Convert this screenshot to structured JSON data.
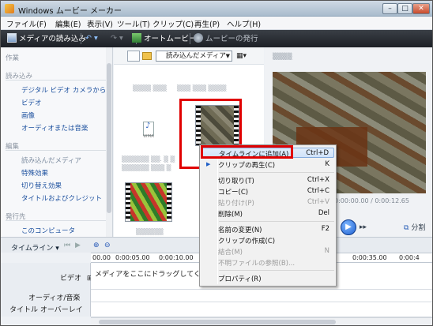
{
  "window": {
    "title": "Windows ムービー メーカー",
    "min": "–",
    "max": "□",
    "close": "✕"
  },
  "menu": [
    "ファイル(F)",
    "編集(E)",
    "表示(V)",
    "ツール(T)",
    "クリップ(C)",
    "再生(P)",
    "ヘルプ(H)"
  ],
  "toolbar": {
    "import": "メディアの読み込み",
    "automovie": "オートムービー",
    "publish": "ムービーの発行"
  },
  "taskpane": {
    "tasks_header": "作業",
    "import_header": "読み込み",
    "import_links": [
      "デジタル ビデオ カメラから",
      "ビデオ",
      "画像",
      "オーディオまたは音楽"
    ],
    "edit_header": "編集",
    "edit_links": [
      "読み込んだメディア",
      "特殊効果",
      "切り替え効果",
      "タイトルおよびクレジット"
    ],
    "publish_header": "発行先",
    "publish_links": [
      "このコンピュータ"
    ]
  },
  "content": {
    "combo": "読み込んだメディア",
    "audio_label": "WMA"
  },
  "preview": {
    "time": "0:00:00.00 / 0:00:12.65",
    "split": "分割"
  },
  "timeline": {
    "label": "タイムライン",
    "ruler": [
      "00.00",
      "0:00:05.00",
      "0:00:10.00",
      "0:00:35.00",
      "0:00:4"
    ],
    "tracks": [
      "ビデオ",
      "オーディオ/音楽",
      "タイトル オーバーレイ"
    ],
    "drop_hint": "メディアをここにドラッグしてくださ"
  },
  "context_menu": {
    "items": [
      {
        "label": "タイムラインに追加(A)",
        "shortcut": "Ctrl+D",
        "disabled": false
      },
      {
        "label": "クリップの再生(C)",
        "shortcut": "K",
        "disabled": false
      },
      {
        "label": "切り取り(T)",
        "shortcut": "Ctrl+X",
        "disabled": false
      },
      {
        "label": "コピー(C)",
        "shortcut": "Ctrl+C",
        "disabled": false
      },
      {
        "label": "貼り付け(P)",
        "shortcut": "Ctrl+V",
        "disabled": true
      },
      {
        "label": "削除(M)",
        "shortcut": "Del",
        "disabled": false
      },
      {
        "label": "名前の変更(N)",
        "shortcut": "F2",
        "disabled": false
      },
      {
        "label": "クリップの作成(C)",
        "shortcut": "",
        "disabled": false
      },
      {
        "label": "結合(M)",
        "shortcut": "N",
        "disabled": true
      },
      {
        "label": "不明ファイルの参照(B)...",
        "shortcut": "",
        "disabled": true
      },
      {
        "label": "プロパティ(R)",
        "shortcut": "",
        "disabled": false
      }
    ]
  },
  "colors": {
    "highlight_red": "#e00000",
    "link_blue": "#1b4f9e",
    "toolbar_dark": "#1d2026"
  }
}
